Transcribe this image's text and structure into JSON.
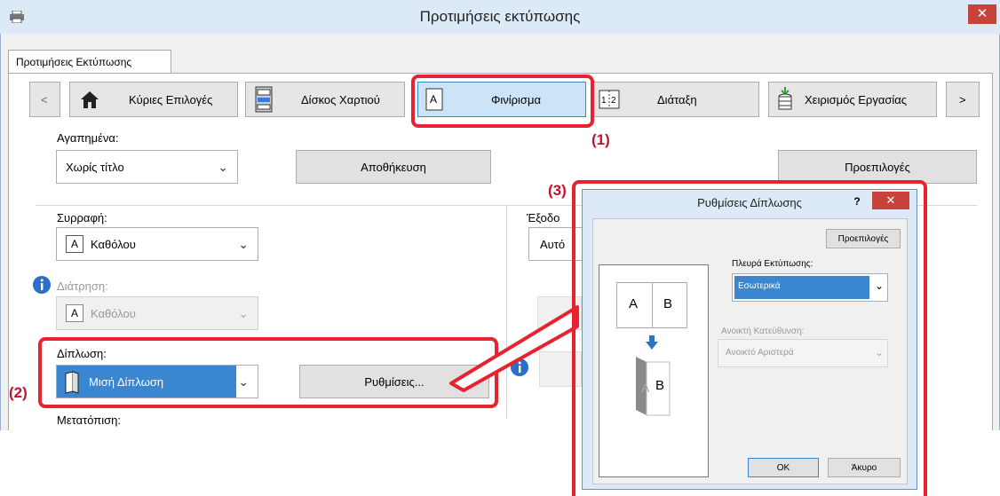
{
  "window": {
    "title": "Προτιμήσεις εκτύπωσης",
    "close": "✕",
    "tab": "Προτιμήσεις Εκτύπωσης"
  },
  "nav": {
    "prev": "<",
    "next": ">",
    "items": [
      {
        "label": "Κύριες Επιλογές",
        "icon": "home-icon"
      },
      {
        "label": "Δίσκος Χαρτιού",
        "icon": "paper-tray-icon"
      },
      {
        "label": "Φινίρισμα",
        "icon": "finishing-icon"
      },
      {
        "label": "Διάταξη",
        "icon": "layout-icon"
      },
      {
        "label": "Χειρισμός Εργασίας",
        "icon": "job-handling-icon"
      }
    ]
  },
  "favorites": {
    "label": "Αγαπημένα:",
    "value": "Χωρίς τίτλο",
    "save": "Αποθήκευση",
    "defaults": "Προεπιλογές"
  },
  "collate": {
    "label": "Συρραφή:",
    "value": "Καθόλου",
    "icon_letter": "A"
  },
  "punch": {
    "label": "Διάτρηση:",
    "value": "Καθόλου",
    "icon_letter": "A"
  },
  "fold": {
    "label": "Δίπλωση:",
    "value": "Μισή Δίπλωση",
    "settings": "Ρυθμίσεις..."
  },
  "shift": {
    "label": "Μετατόπιση:"
  },
  "output": {
    "label": "Έξοδο",
    "value": "Αυτό"
  },
  "callouts": {
    "one": "(1)",
    "two": "(2)",
    "three": "(3)"
  },
  "dialog": {
    "title": "Ρυθμίσεις Δίπλωσης",
    "help": "?",
    "close": "✕",
    "defaults": "Προεπιλογές",
    "print_side_label": "Πλευρά Εκτύπωσης:",
    "print_side_value": "Εσωτερικά",
    "open_dir_label": "Ανοικτή Κατεύθυνση:",
    "open_dir_value": "Ανοικτό Αριστερά",
    "preview_a": "A",
    "preview_b": "B",
    "ok": "OK",
    "cancel": "Άκυρο"
  },
  "colors": {
    "accent": "#3a86d1",
    "highlight": "#e8232f",
    "titlebar": "#dce9f7"
  }
}
